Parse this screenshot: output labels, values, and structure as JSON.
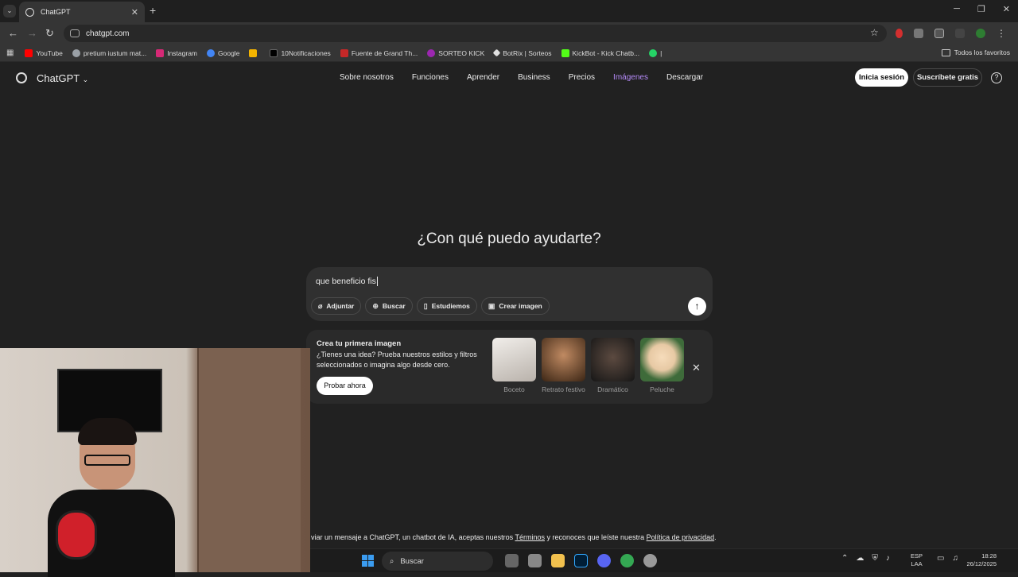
{
  "browser": {
    "tab_title": "ChatGPT",
    "tab_close": "✕",
    "new_tab": "+",
    "url": "chatgpt.com",
    "bookmarks": [
      {
        "label": "YouTube",
        "color": "#ff0000"
      },
      {
        "label": "pretium iustum mat...",
        "color": "#9aa0a6"
      },
      {
        "label": "Instagram",
        "color": "#d62976"
      },
      {
        "label": "Google",
        "color": "#4285f4"
      },
      {
        "label": "",
        "color": "#f4b400"
      },
      {
        "label": "10Notificaciones",
        "color": "#000000"
      },
      {
        "label": "Fuente de Grand Th...",
        "color": "#c62828"
      },
      {
        "label": "SORTEO KICK",
        "color": "#9c27b0"
      },
      {
        "label": "BotRix | Sorteos",
        "color": "#e0e0e0"
      },
      {
        "label": "KickBot - Kick Chatb...",
        "color": "#53fc18"
      },
      {
        "label": "|",
        "color": "#25d366"
      }
    ],
    "all_bookmarks": "Todos los favoritos"
  },
  "site": {
    "brand": "ChatGPT",
    "nav": [
      "Sobre nosotros",
      "Funciones",
      "Aprender",
      "Business",
      "Precios",
      "Imágenes",
      "Descargar"
    ],
    "active_nav": "Imágenes",
    "login": "Inicia sesión",
    "signup": "Suscríbete gratis",
    "help": "?"
  },
  "main": {
    "headline": "¿Con qué puedo ayudarte?",
    "prompt_value": "que beneficio fis",
    "chips": [
      {
        "label": "Adjuntar",
        "icon": "paperclip-icon",
        "glyph": "⌀"
      },
      {
        "label": "Buscar",
        "icon": "globe-icon",
        "glyph": "⊕"
      },
      {
        "label": "Estudiemos",
        "icon": "book-icon",
        "glyph": "▯"
      },
      {
        "label": "Crear imagen",
        "icon": "image-icon",
        "glyph": "▣"
      }
    ],
    "send_glyph": "↑"
  },
  "promo": {
    "title": "Crea tu primera imagen",
    "text": "¿Tienes una idea? Prueba nuestros estilos y filtros seleccionados o imagina algo desde cero.",
    "button": "Probar ahora",
    "close": "✕",
    "styles": [
      {
        "label": "Boceto",
        "color": "#d9d4cf"
      },
      {
        "label": "Retrato festivo",
        "color": "#6b4a2a"
      },
      {
        "label": "Dramático",
        "color": "#3a3a3a"
      },
      {
        "label": "Peluche",
        "color": "#e7c9a4"
      }
    ]
  },
  "footer": {
    "text_before": "viar un mensaje a ChatGPT, un chatbot de IA, aceptas nuestros ",
    "terms": "Términos",
    "text_middle": " y reconoces que leíste nuestra ",
    "privacy": "Política de privacidad",
    "text_end": "."
  },
  "taskbar": {
    "search": "Buscar",
    "lang_1": "ESP",
    "lang_2": "LAA",
    "time": "18:28",
    "date": "26/12/2025"
  }
}
